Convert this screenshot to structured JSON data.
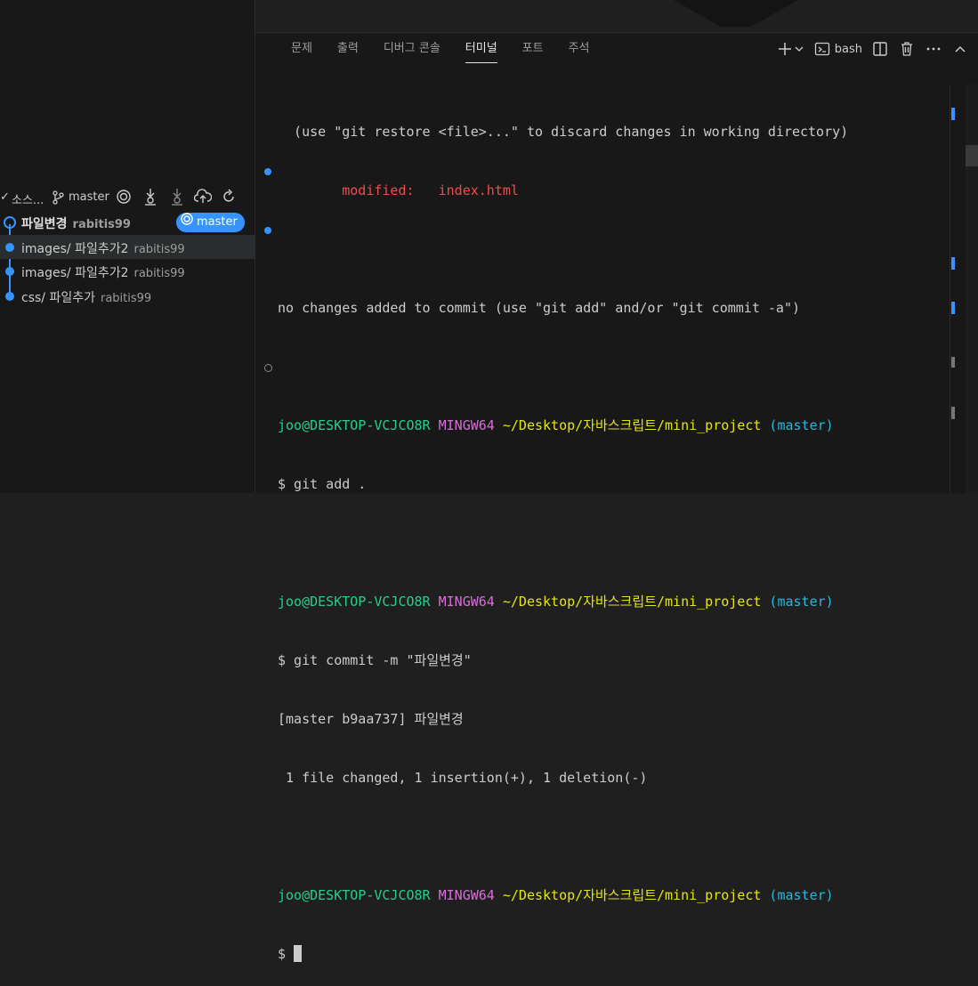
{
  "scm": {
    "header": {
      "title": "소스...",
      "branch": "master"
    },
    "commits": [
      {
        "message": "파일변경",
        "author": "rabitis99",
        "badge": "master"
      },
      {
        "message": "images/ 파일추가2",
        "author": "rabitis99"
      },
      {
        "message": "images/ 파일추가2",
        "author": "rabitis99"
      },
      {
        "message": "css/ 파일추가",
        "author": "rabitis99"
      }
    ]
  },
  "panel": {
    "tabs": [
      "문제",
      "출력",
      "디버그 콘솔",
      "터미널",
      "포트",
      "주석"
    ],
    "active_tab": "터미널",
    "terminal_name": "bash"
  },
  "terminal": {
    "restore_hint": "  (use \"git restore <file>...\" to discard changes in working directory)",
    "modified_label": "        modified:   index.html",
    "no_changes": "no changes added to commit (use \"git add\" and/or \"git commit -a\")",
    "prompt_user": "joo@DESKTOP-VCJCO8R",
    "prompt_env": "MINGW64",
    "prompt_path": "~/Desktop/자바스크립트/mini_project",
    "prompt_branch": "(master)",
    "cmd_add": "$ git add .",
    "cmd_commit": "$ git commit -m \"파일변경\"",
    "commit_result": "[master b9aa737] 파일변경",
    "commit_stats": " 1 file changed, 1 insertion(+), 1 deletion(-)",
    "prompt_symbol": "$ "
  },
  "colors": {
    "accent": "#3794ff",
    "red": "#f14c4c",
    "green": "#23d18b",
    "magenta": "#d670d6",
    "yellow": "#e5e510",
    "cyan": "#29b8db"
  }
}
